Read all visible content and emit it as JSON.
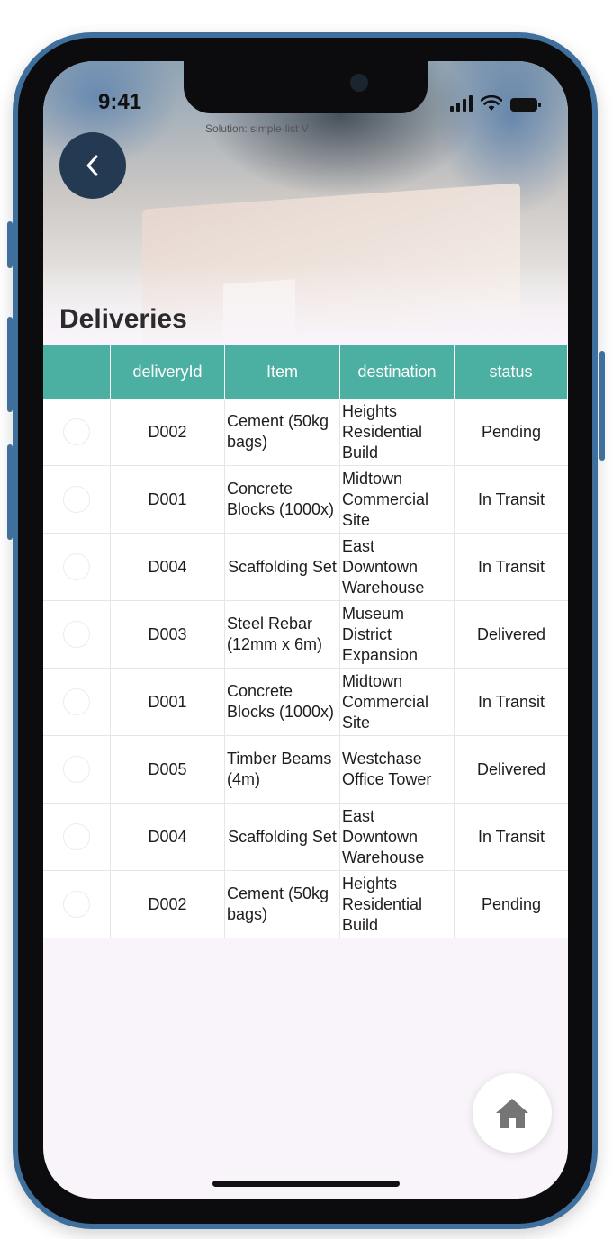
{
  "status_bar": {
    "time": "9:41"
  },
  "header": {
    "solution_label": "Solution: simple-list  V",
    "title": "Deliveries"
  },
  "table": {
    "columns": [
      "",
      "deliveryId",
      "Item",
      "destination",
      "status"
    ],
    "rows": [
      {
        "deliveryId": "D002",
        "item": "Cement (50kg bags)",
        "destination": "Heights Residential Build",
        "status": "Pending"
      },
      {
        "deliveryId": "D001",
        "item": "Concrete Blocks (1000x)",
        "destination": "Midtown Commercial Site",
        "status": "In Transit"
      },
      {
        "deliveryId": "D004",
        "item": "Scaffolding Set",
        "destination": "East Downtown Warehouse",
        "status": "In Transit"
      },
      {
        "deliveryId": "D003",
        "item": "Steel Rebar (12mm x 6m)",
        "destination": "Museum District Expansion",
        "status": "Delivered"
      },
      {
        "deliveryId": "D001",
        "item": "Concrete Blocks (1000x)",
        "destination": "Midtown Commercial Site",
        "status": "In Transit"
      },
      {
        "deliveryId": "D005",
        "item": "Timber Beams (4m)",
        "destination": "Westchase Office Tower",
        "status": "Delivered"
      },
      {
        "deliveryId": "D004",
        "item": "Scaffolding Set",
        "destination": "East Downtown Warehouse",
        "status": "In Transit"
      },
      {
        "deliveryId": "D002",
        "item": "Cement (50kg bags)",
        "destination": "Heights Residential Build",
        "status": "Pending"
      }
    ]
  },
  "icons": {
    "back": "chevron-left-icon",
    "home": "home-icon"
  },
  "colors": {
    "header_bg": "#4bafa1",
    "back_button": "#243a52",
    "frame": "#3f6f9c"
  }
}
